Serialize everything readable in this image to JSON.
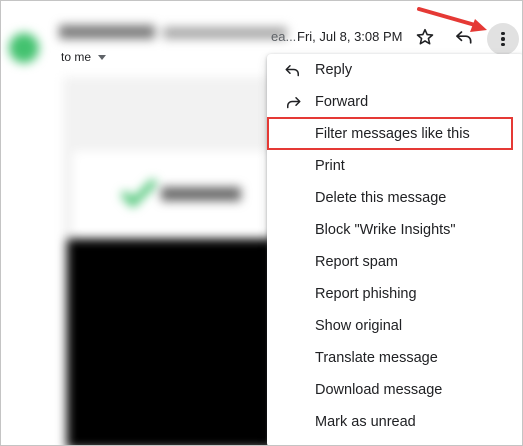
{
  "header": {
    "sender_ellipsis": "ea...",
    "date": "Fri, Jul 8, 3:08 PM",
    "recipient_label": "to me"
  },
  "icons": {
    "star": "star-icon",
    "reply": "reply-icon",
    "more": "more-vert-icon"
  },
  "colors": {
    "highlight_border": "#e53935",
    "arrow": "#e53935",
    "avatar": "#43c26f"
  },
  "menu": {
    "highlighted_item": "Filter messages like this",
    "items": [
      {
        "label": "Reply",
        "icon": "reply-icon"
      },
      {
        "label": "Forward",
        "icon": "forward-icon"
      },
      {
        "label": "Filter messages like this",
        "icon": ""
      },
      {
        "label": "Print",
        "icon": ""
      },
      {
        "label": "Delete this message",
        "icon": ""
      },
      {
        "label": "Block \"Wrike Insights\"",
        "icon": ""
      },
      {
        "label": "Report spam",
        "icon": ""
      },
      {
        "label": "Report phishing",
        "icon": ""
      },
      {
        "label": "Show original",
        "icon": ""
      },
      {
        "label": "Translate message",
        "icon": ""
      },
      {
        "label": "Download message",
        "icon": ""
      },
      {
        "label": "Mark as unread",
        "icon": ""
      }
    ]
  }
}
